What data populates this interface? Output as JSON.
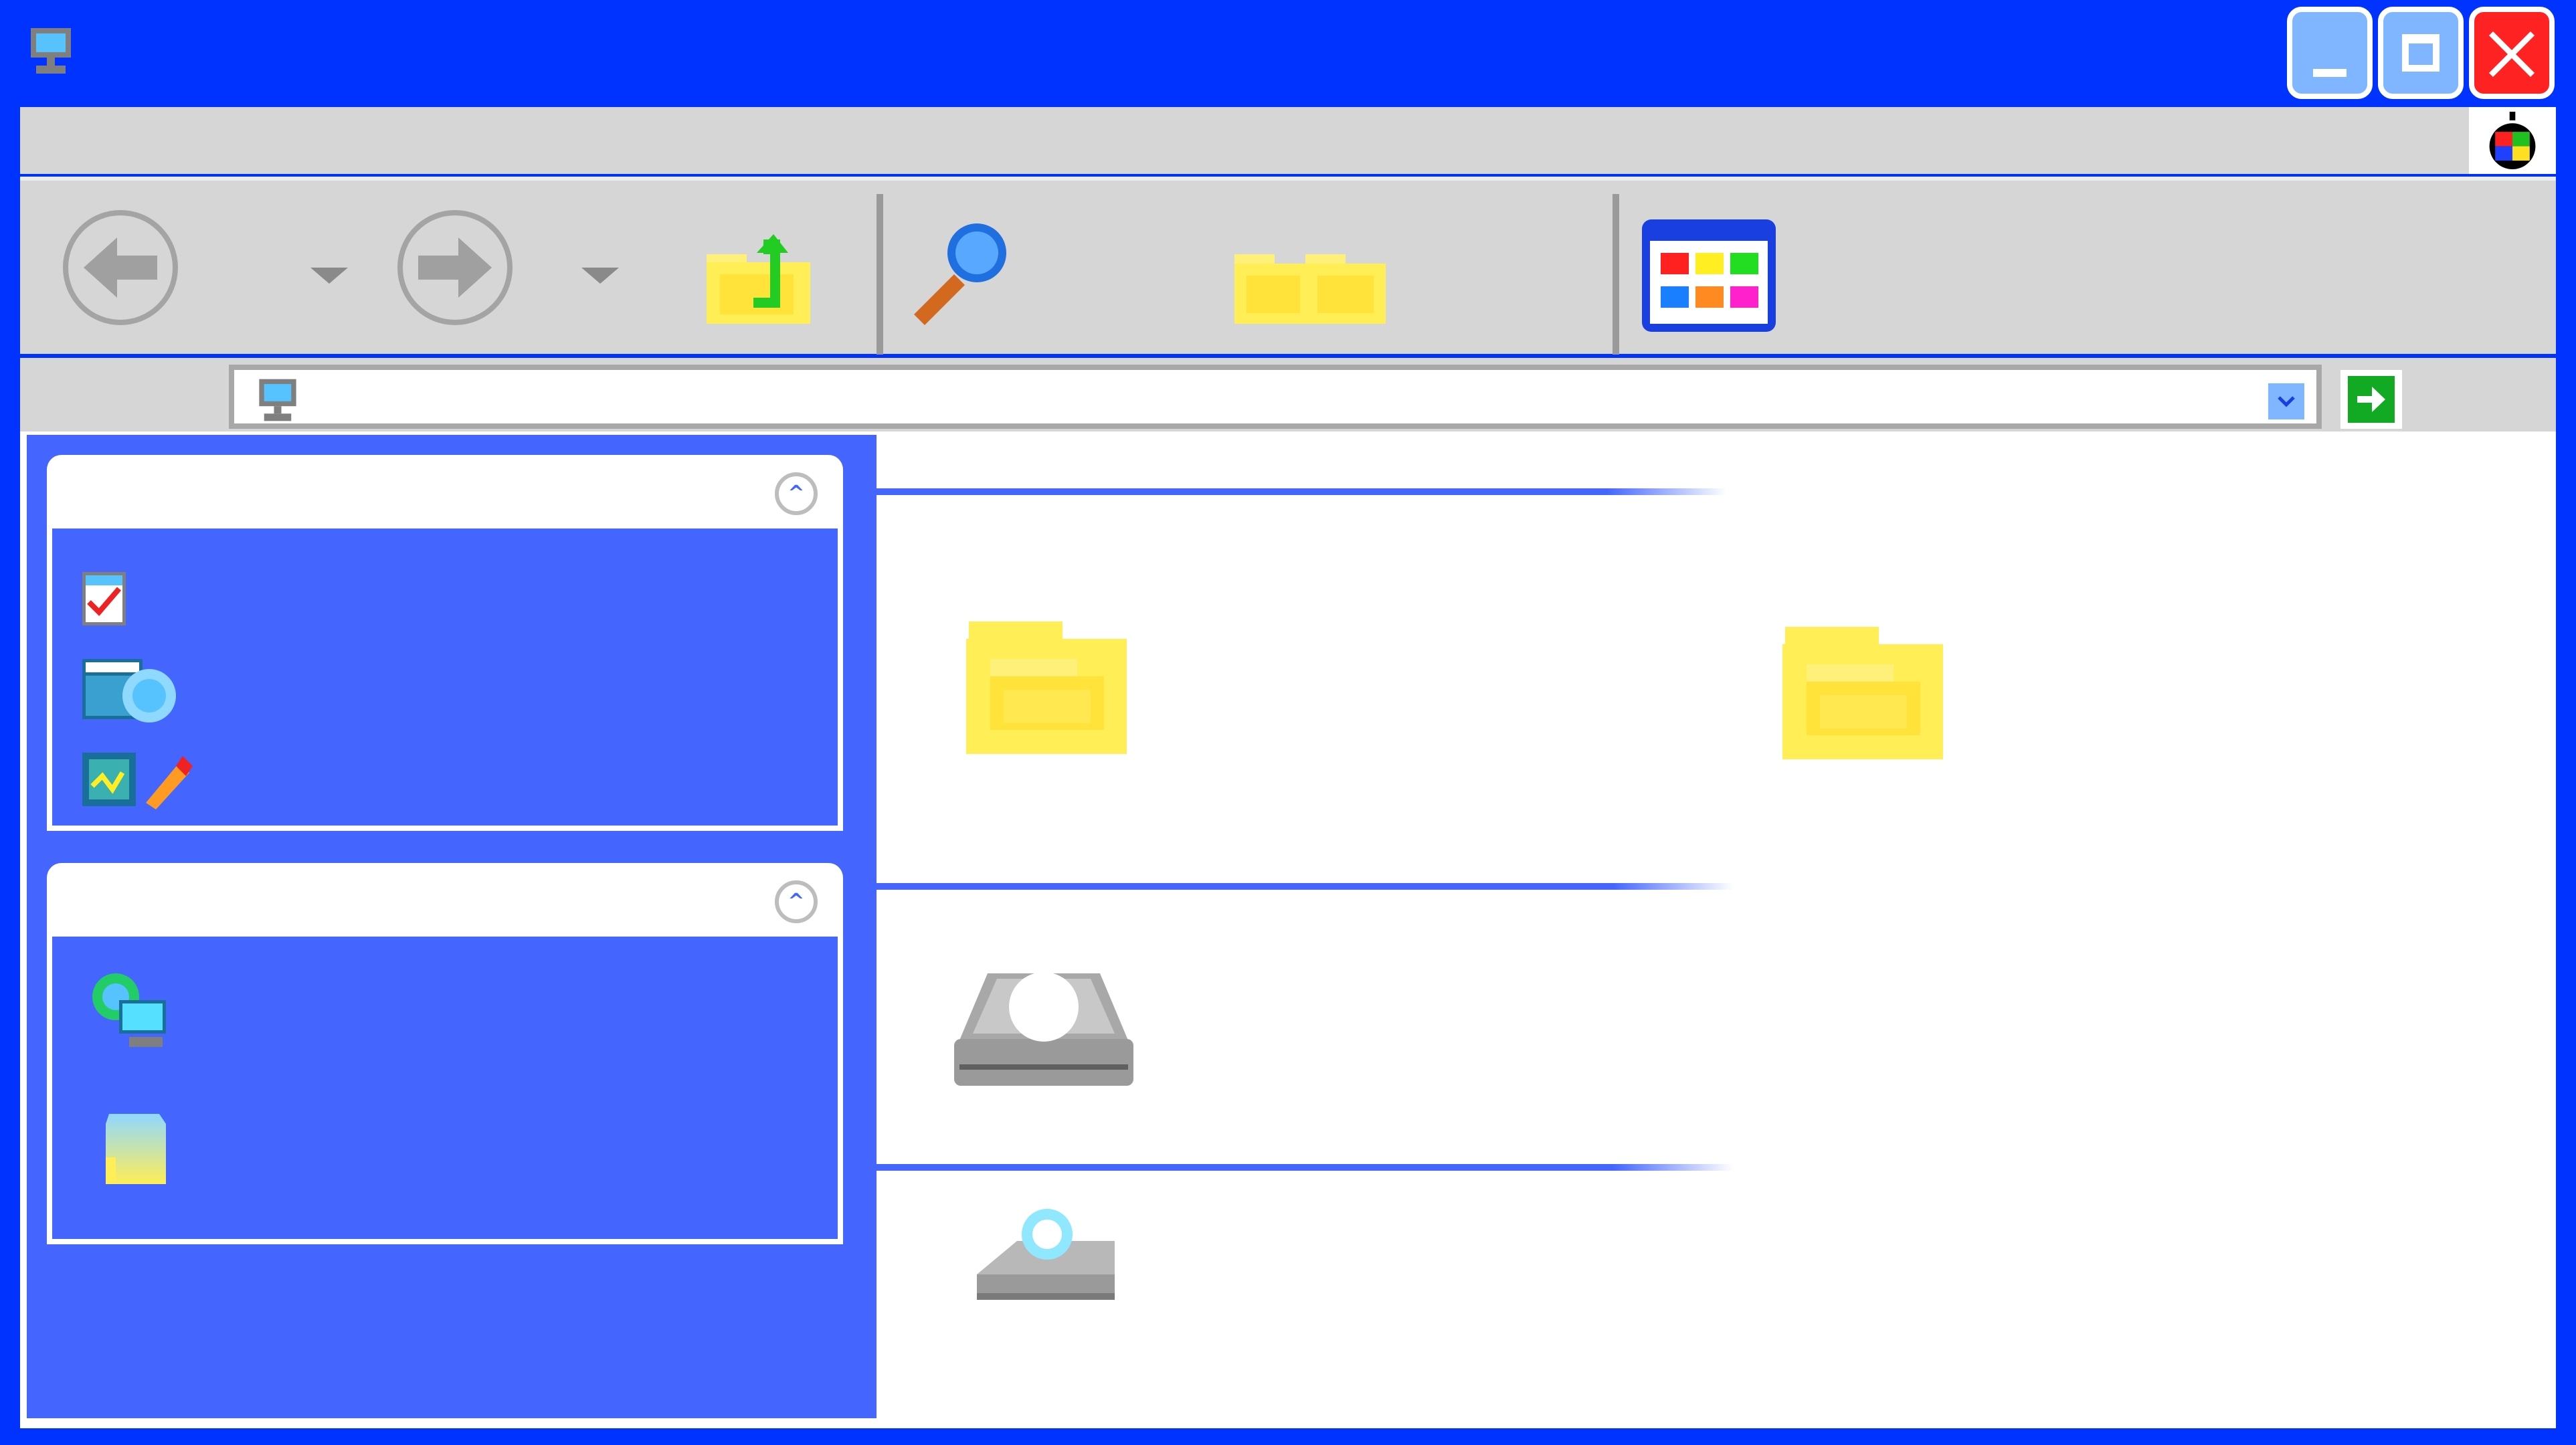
{
  "window": {
    "title": "",
    "icon": "computer-icon",
    "buttons": [
      "minimize-icon",
      "maximize-icon",
      "close-icon"
    ]
  },
  "menubar": {
    "items": [],
    "corner_icon": "windows-flag-icon"
  },
  "toolbar": {
    "buttons": [
      {
        "name": "back-button",
        "icon": "back-arrow-icon",
        "label": ""
      },
      {
        "name": "forward-button",
        "icon": "forward-arrow-icon",
        "label": ""
      },
      {
        "name": "up-button",
        "icon": "folder-up-icon",
        "label": ""
      },
      {
        "name": "search-button",
        "icon": "search-icon",
        "label": ""
      },
      {
        "name": "folders-button",
        "icon": "folders-icon",
        "label": ""
      },
      {
        "name": "views-button",
        "icon": "views-icon",
        "label": ""
      }
    ]
  },
  "address": {
    "label": "",
    "value": "",
    "icon": "computer-icon",
    "go_label": ""
  },
  "sidebar": {
    "panels": [
      {
        "title": "",
        "items": [
          {
            "icon": "view-system-info-icon",
            "label": ""
          },
          {
            "icon": "add-remove-programs-icon",
            "label": ""
          },
          {
            "icon": "change-setting-icon",
            "label": ""
          }
        ]
      },
      {
        "title": "",
        "items": [
          {
            "icon": "network-places-icon",
            "label": ""
          },
          {
            "icon": "my-documents-icon",
            "label": ""
          }
        ]
      }
    ]
  },
  "main": {
    "groups": [
      {
        "title": "",
        "items": [
          {
            "icon": "folder-icon",
            "label": ""
          },
          {
            "icon": "folder-icon",
            "label": ""
          }
        ]
      },
      {
        "title": "",
        "items": [
          {
            "icon": "hard-drive-icon",
            "label": ""
          }
        ]
      },
      {
        "title": "",
        "items": [
          {
            "icon": "removable-drive-icon",
            "label": ""
          }
        ]
      }
    ]
  },
  "colors": {
    "titlebar": "#0033ff",
    "toolbar": "#d6d6d6",
    "sidebar": "#4466ff",
    "folder": "#ffee55",
    "close": "#ff2222"
  }
}
